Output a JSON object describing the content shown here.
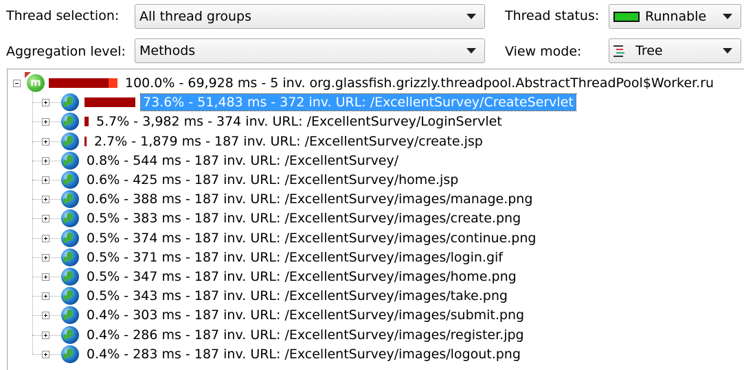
{
  "controls": {
    "thread_selection_label": "Thread selection:",
    "thread_selection_value": "All thread groups",
    "thread_status_label": "Thread status:",
    "thread_status_value": "Runnable",
    "thread_status_color": "#21c421",
    "aggregation_label": "Aggregation level:",
    "aggregation_value": "Methods",
    "view_mode_label": "View mode:",
    "view_mode_value": "Tree",
    "dropdown_icon": "chevron-down-icon"
  },
  "tree": {
    "root": {
      "icon": "method-icon",
      "icon_letter": "m",
      "percent": 1.0,
      "text": "100.0% - 69,928 ms - 5 inv. org.glassfish.grizzly.threadpool.AbstractThreadPool$Worker.ru"
    },
    "children": [
      {
        "icon": "globe-icon",
        "percent": 0.736,
        "selected": true,
        "text": "73.6% - 51,483 ms - 372 inv. URL: /ExcellentSurvey/CreateServlet"
      },
      {
        "icon": "globe-icon",
        "percent": 0.057,
        "selected": false,
        "text": "5.7% - 3,982 ms - 374 inv. URL: /ExcellentSurvey/LoginServlet"
      },
      {
        "icon": "globe-icon",
        "percent": 0.027,
        "selected": false,
        "text": "2.7% - 1,879 ms - 187 inv. URL: /ExcellentSurvey/create.jsp"
      },
      {
        "icon": "globe-icon",
        "percent": 0.008,
        "selected": false,
        "text": "0.8% - 544 ms - 187 inv. URL: /ExcellentSurvey/"
      },
      {
        "icon": "globe-icon",
        "percent": 0.006,
        "selected": false,
        "text": "0.6% - 425 ms - 187 inv. URL: /ExcellentSurvey/home.jsp"
      },
      {
        "icon": "globe-icon",
        "percent": 0.006,
        "selected": false,
        "text": "0.6% - 388 ms - 187 inv. URL: /ExcellentSurvey/images/manage.png"
      },
      {
        "icon": "globe-icon",
        "percent": 0.005,
        "selected": false,
        "text": "0.5% - 383 ms - 187 inv. URL: /ExcellentSurvey/images/create.png"
      },
      {
        "icon": "globe-icon",
        "percent": 0.005,
        "selected": false,
        "text": "0.5% - 374 ms - 187 inv. URL: /ExcellentSurvey/images/continue.png"
      },
      {
        "icon": "globe-icon",
        "percent": 0.005,
        "selected": false,
        "text": "0.5% - 371 ms - 187 inv. URL: /ExcellentSurvey/images/login.gif"
      },
      {
        "icon": "globe-icon",
        "percent": 0.005,
        "selected": false,
        "text": "0.5% - 347 ms - 187 inv. URL: /ExcellentSurvey/images/home.png"
      },
      {
        "icon": "globe-icon",
        "percent": 0.005,
        "selected": false,
        "text": "0.5% - 343 ms - 187 inv. URL: /ExcellentSurvey/images/take.png"
      },
      {
        "icon": "globe-icon",
        "percent": 0.004,
        "selected": false,
        "text": "0.4% - 303 ms - 187 inv. URL: /ExcellentSurvey/images/submit.png"
      },
      {
        "icon": "globe-icon",
        "percent": 0.004,
        "selected": false,
        "text": "0.4% - 286 ms - 187 inv. URL: /ExcellentSurvey/images/register.jpg"
      },
      {
        "icon": "globe-icon",
        "percent": 0.004,
        "selected": false,
        "text": "0.4% - 283 ms - 187 inv. URL: /ExcellentSurvey/images/logout.png"
      }
    ]
  }
}
